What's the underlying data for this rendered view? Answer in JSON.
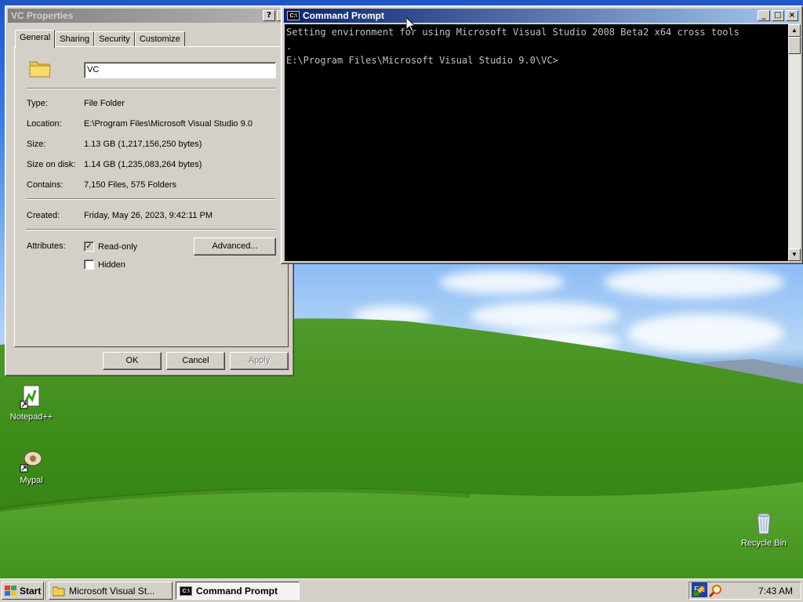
{
  "properties_dialog": {
    "title": "VC Properties",
    "help_button": "?",
    "close_button": "×",
    "tabs": [
      {
        "label": "General"
      },
      {
        "label": "Sharing"
      },
      {
        "label": "Security"
      },
      {
        "label": "Customize"
      }
    ],
    "folder_name": "VC",
    "details": [
      {
        "label": "Type:",
        "value": "File Folder"
      },
      {
        "label": "Location:",
        "value": "E:\\Program Files\\Microsoft Visual Studio 9.0"
      },
      {
        "label": "Size:",
        "value": "1.13 GB (1,217,156,250 bytes)"
      },
      {
        "label": "Size on disk:",
        "value": "1.14 GB (1,235,083,264 bytes)"
      },
      {
        "label": "Contains:",
        "value": "7,150 Files, 575 Folders"
      }
    ],
    "created_label": "Created:",
    "created_value": "Friday, May 26, 2023, 9:42:11 PM",
    "attributes_label": "Attributes:",
    "readonly_label": "Read-only",
    "readonly_checked": true,
    "hidden_label": "Hidden",
    "hidden_checked": false,
    "advanced_button": "Advanced...",
    "ok_button": "OK",
    "cancel_button": "Cancel",
    "apply_button": "Apply"
  },
  "command_prompt": {
    "title": "Command Prompt",
    "minimize": "_",
    "maximize": "□",
    "close": "×",
    "lines": [
      "Setting environment for using Microsoft Visual Studio 2008 Beta2 x64 cross tools",
      ".",
      "",
      "E:\\Program Files\\Microsoft Visual Studio 9.0\\VC>"
    ]
  },
  "desktop_icons": [
    {
      "label": "Notepad++",
      "icon": "notepad-plus-plus-icon"
    },
    {
      "label": "Mypal",
      "icon": "mypal-browser-icon"
    },
    {
      "label": "Recycle Bin",
      "icon": "recycle-bin-icon"
    }
  ],
  "taskbar": {
    "start_label": "Start",
    "tasks": [
      {
        "label": "Microsoft Visual St...",
        "icon": "folder-icon",
        "active": false
      },
      {
        "label": "Command Prompt",
        "icon": "console-icon",
        "active": true
      }
    ],
    "language": "EN",
    "clock": "7:43 AM"
  },
  "colors": {
    "inactive_title": "#808080",
    "active_title": "#0a246a",
    "dialog_face": "#d4d0c8",
    "console_bg": "#000000",
    "console_text": "#c0c0c0"
  }
}
